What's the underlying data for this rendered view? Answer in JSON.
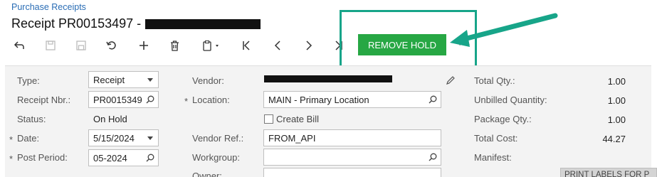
{
  "breadcrumb": "Purchase Receipts",
  "title": "Receipt PR00153497 -",
  "toolbar": {
    "remove_hold_label": "REMOVE HOLD",
    "more_label": "···",
    "icons": [
      "undo-icon",
      "save-icon",
      "save-close-icon",
      "cancel-icon",
      "add-icon",
      "delete-icon",
      "copy-paste-icon",
      "first-record-icon",
      "previous-record-icon",
      "next-record-icon",
      "last-record-icon"
    ]
  },
  "accent_color": "#27a744",
  "highlight_color": "#17a589",
  "form": {
    "type_label": "Type:",
    "type_value": "Receipt",
    "receipt_nbr_label": "Receipt Nbr.:",
    "receipt_nbr_value": "PR0015349",
    "status_label": "Status:",
    "status_value": "On Hold",
    "date_label": "Date:",
    "date_value": "5/15/2024",
    "post_period_label": "Post Period:",
    "post_period_value": "05-2024",
    "vendor_label": "Vendor:",
    "location_label": "Location:",
    "location_value": "MAIN - Primary Location",
    "create_bill_label": "Create Bill",
    "create_bill_checked": false,
    "vendor_ref_label": "Vendor Ref.:",
    "vendor_ref_value": "FROM_API",
    "workgroup_label": "Workgroup:",
    "workgroup_value": "",
    "owner_label": "Owner:",
    "total_qty_label": "Total Qty.:",
    "total_qty_value": "1.00",
    "unbilled_qty_label": "Unbilled Quantity:",
    "unbilled_qty_value": "1.00",
    "package_qty_label": "Package Qty.:",
    "package_qty_value": "1.00",
    "total_cost_label": "Total Cost:",
    "total_cost_value": "44.27",
    "manifest_label": "Manifest:",
    "required_marker": "*",
    "print_labels_label": "PRINT LABELS FOR P"
  }
}
